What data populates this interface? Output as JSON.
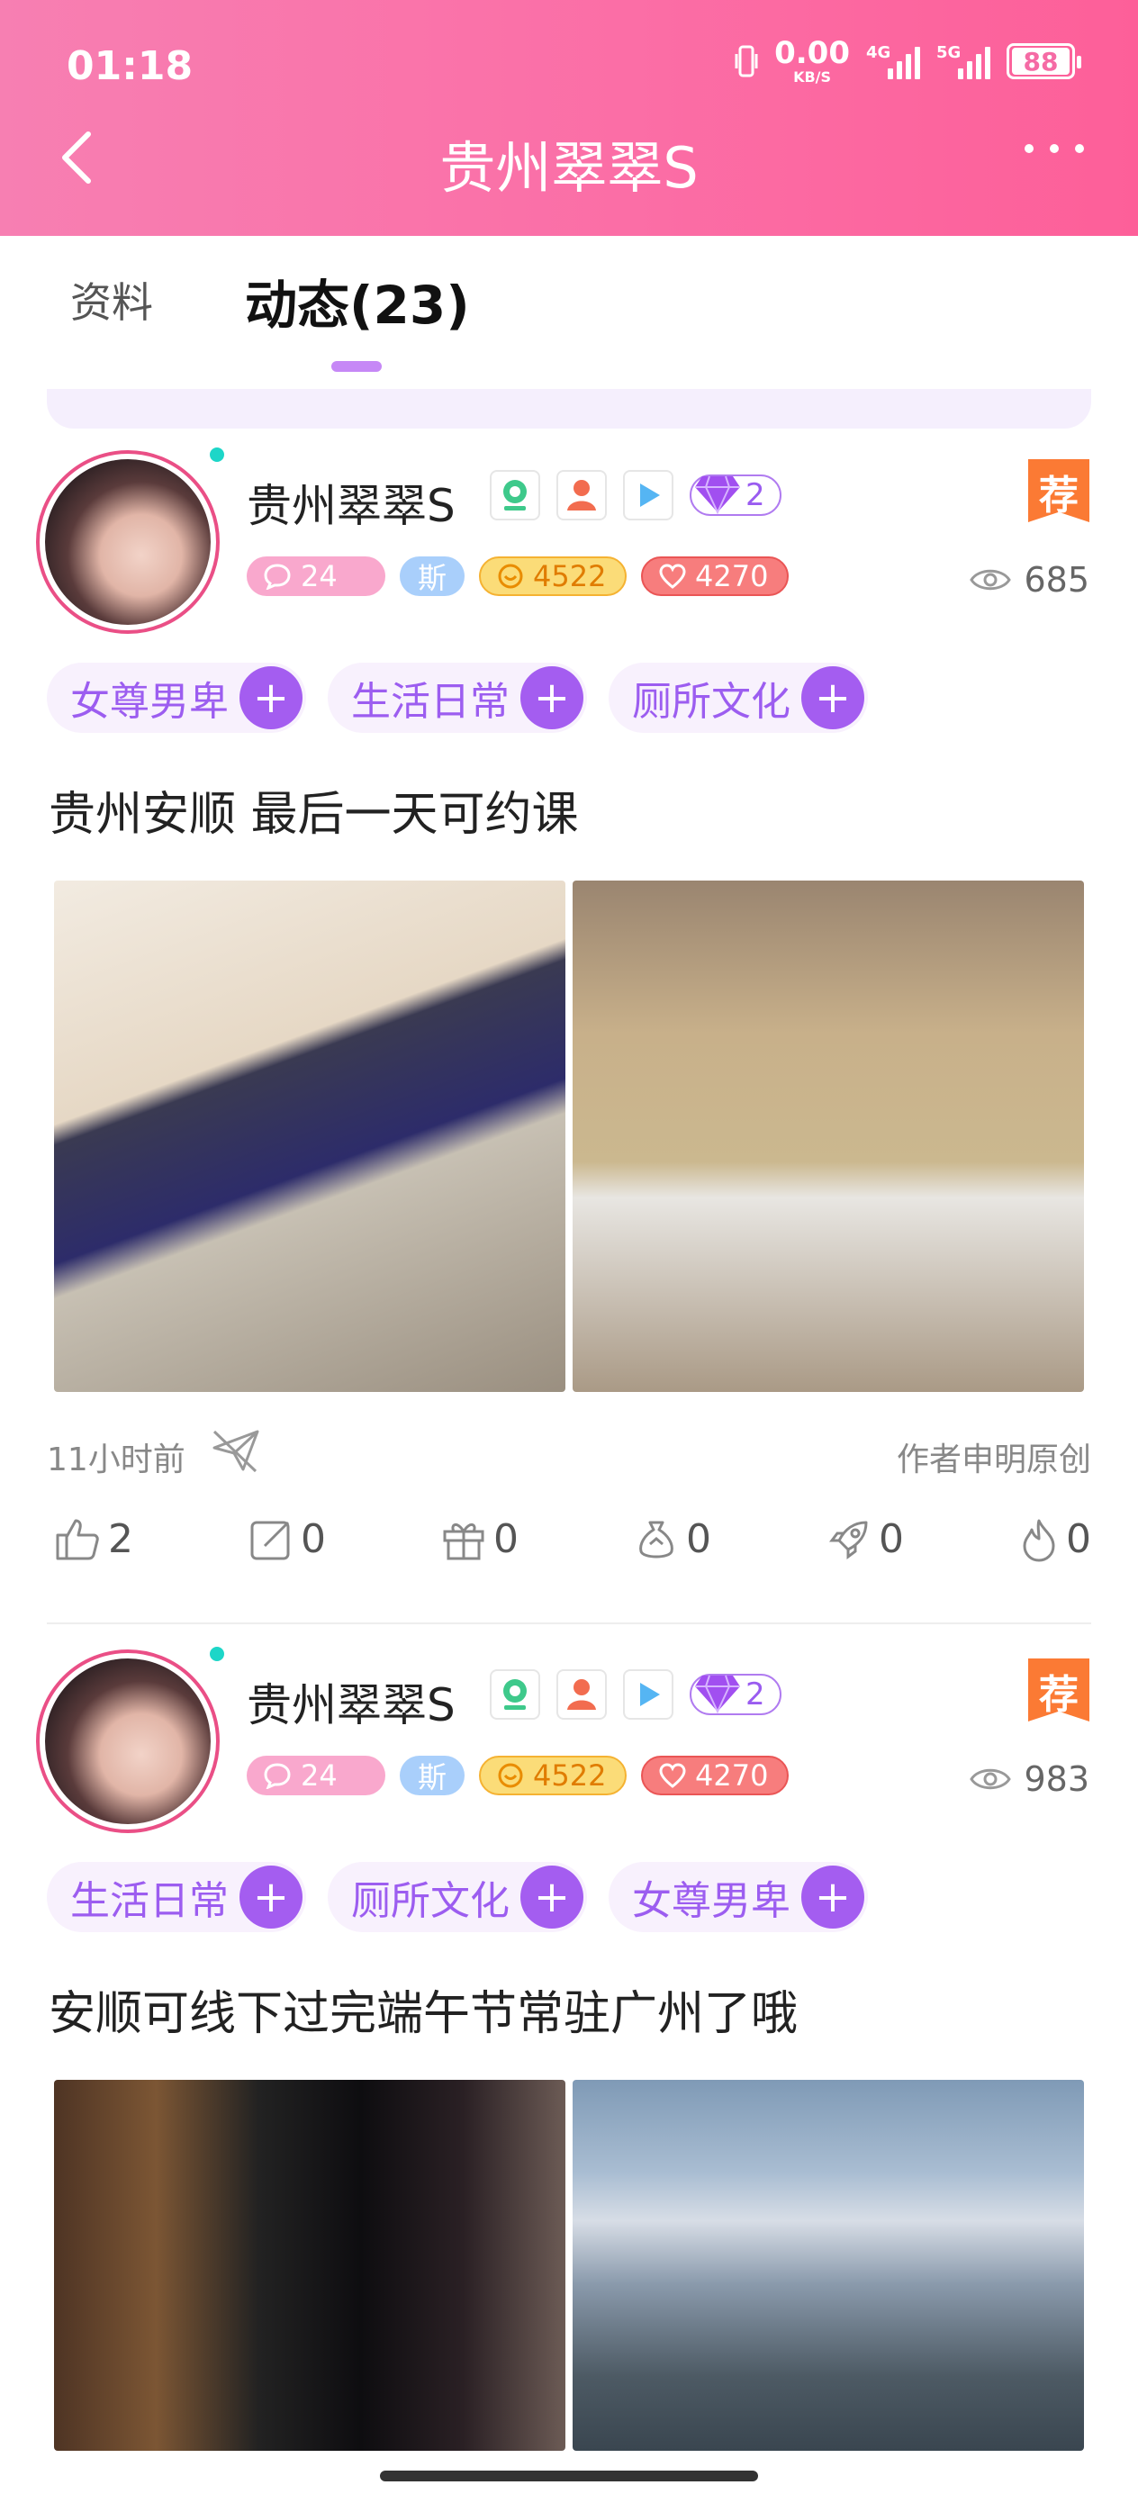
{
  "status_bar": {
    "time": "01:18",
    "net_speed_value": "0.00",
    "net_speed_unit": "KB/S",
    "sig1_label": "4G",
    "sig2_label": "5G",
    "battery": "88"
  },
  "header": {
    "title": "贵州翠翠S"
  },
  "tabs": [
    {
      "label": "资料"
    },
    {
      "label": "动态(23)"
    }
  ],
  "posts": [
    {
      "name": "贵州翠翠S",
      "gem_level": "2",
      "recommend_label": "荐",
      "chat_count": "24",
      "si_label": "斯",
      "gold_count": "4522",
      "heart_count": "4270",
      "views": "685",
      "tags": [
        "女尊男卑",
        "生活日常",
        "厕所文化"
      ],
      "text": "贵州安顺 最后一天可约课",
      "time": "11小时前",
      "original_label": "作者申明原创",
      "likes": "2",
      "comments": "0",
      "gifts": "0",
      "rewards": "0",
      "boosts": "0",
      "hot": "0"
    },
    {
      "name": "贵州翠翠S",
      "gem_level": "2",
      "recommend_label": "荐",
      "chat_count": "24",
      "si_label": "斯",
      "gold_count": "4522",
      "heart_count": "4270",
      "views": "983",
      "tags": [
        "生活日常",
        "厕所文化",
        "女尊男卑"
      ],
      "text": "安顺可线下过完端午节常驻广州了哦"
    }
  ],
  "colors": {
    "header_gradient_start": "#f77fb2",
    "header_gradient_end": "#fd5f99",
    "tag_text": "#9c5df0",
    "tag_plus": "#a45df0",
    "recommend": "#fb7a34"
  },
  "icons": [
    "back-arrow-icon",
    "more-dots-icon",
    "location-icon",
    "user-icon",
    "play-icon",
    "gem-icon",
    "eye-icon",
    "send-icon",
    "like-icon",
    "comment-icon",
    "gift-icon",
    "reward-icon",
    "rocket-icon",
    "fire-icon"
  ]
}
